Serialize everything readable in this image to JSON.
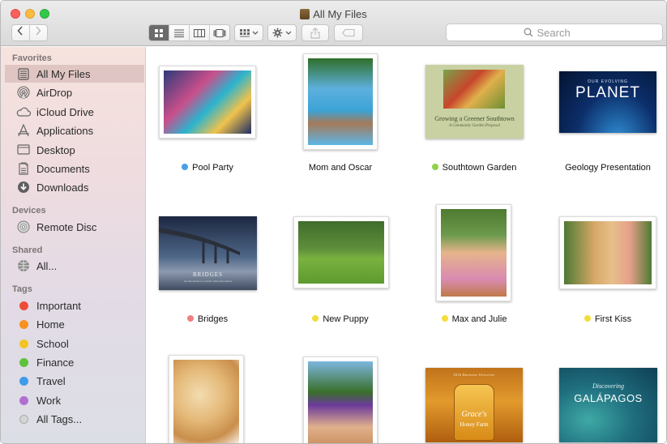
{
  "window": {
    "title": "All My Files"
  },
  "toolbar": {
    "search_placeholder": "Search"
  },
  "sidebar": {
    "favorites_header": "Favorites",
    "favorites": [
      {
        "label": "All My Files",
        "icon": "all-files-icon"
      },
      {
        "label": "AirDrop",
        "icon": "airdrop-icon"
      },
      {
        "label": "iCloud Drive",
        "icon": "cloud-icon"
      },
      {
        "label": "Applications",
        "icon": "applications-icon"
      },
      {
        "label": "Desktop",
        "icon": "desktop-icon"
      },
      {
        "label": "Documents",
        "icon": "documents-icon"
      },
      {
        "label": "Downloads",
        "icon": "downloads-icon"
      }
    ],
    "devices_header": "Devices",
    "devices": [
      {
        "label": "Remote Disc",
        "icon": "disc-icon"
      }
    ],
    "shared_header": "Shared",
    "shared": [
      {
        "label": "All...",
        "icon": "network-icon"
      }
    ],
    "tags_header": "Tags",
    "tags": [
      {
        "label": "Important",
        "color": "#f04b3a"
      },
      {
        "label": "Home",
        "color": "#f7921e"
      },
      {
        "label": "School",
        "color": "#f6c324"
      },
      {
        "label": "Finance",
        "color": "#5fc23b"
      },
      {
        "label": "Travel",
        "color": "#3e9be9"
      },
      {
        "label": "Work",
        "color": "#b26fd0"
      },
      {
        "label": "All Tags...",
        "color": "#c8c8c8"
      }
    ]
  },
  "files": [
    {
      "name": "Pool Party",
      "tag_color": "#4a9ee6"
    },
    {
      "name": "Mom and Oscar",
      "tag_color": null
    },
    {
      "name": "Southtown Garden",
      "tag_color": "#8fd14b"
    },
    {
      "name": "Geology Presentation",
      "tag_color": null
    },
    {
      "name": "Bridges",
      "tag_color": "#ef8080"
    },
    {
      "name": "New Puppy",
      "tag_color": "#f3dd3a"
    },
    {
      "name": "Max and Julie",
      "tag_color": "#f3dd3a"
    },
    {
      "name": "First Kiss",
      "tag_color": "#f3dd3a"
    }
  ],
  "documents": {
    "garden_title": "Growing a Greener Southtown",
    "garden_subtitle": "A Community Garden Proposal",
    "planet_kicker": "OUR EVOLVING",
    "planet_title": "PLANET",
    "bridges_title": "BRIDGES",
    "bridges_subtitle": "An introduction to much older innovations",
    "honey_kicker": "2016 Business Overview",
    "honey_title": "Grace's",
    "honey_subtitle": "Honey Farm",
    "galapagos_kicker": "Discovering",
    "galapagos_title": "GALÁPAGOS"
  }
}
